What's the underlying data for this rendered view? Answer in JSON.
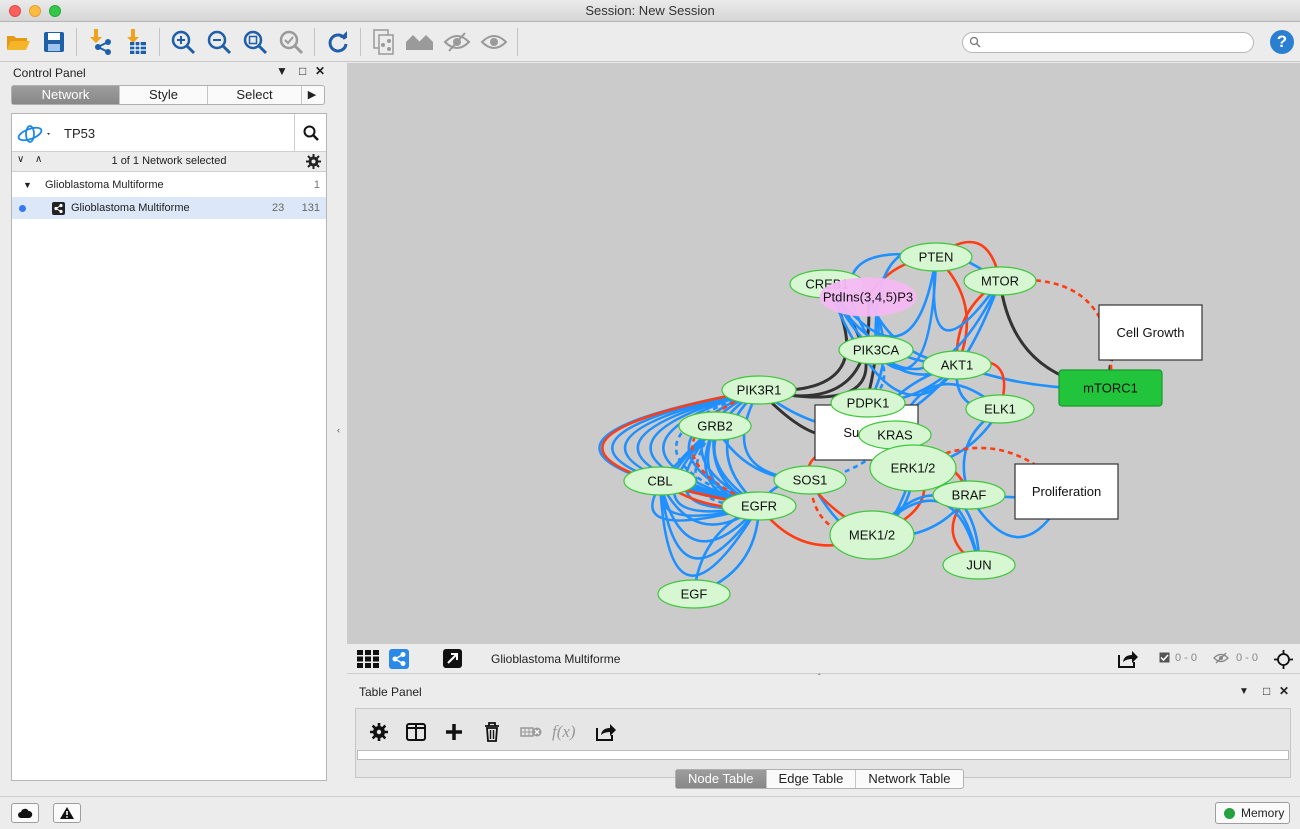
{
  "window": {
    "title": "Session: New Session"
  },
  "toolbar": {
    "icons": [
      "open-session-icon",
      "save-session-icon",
      "import-network-icon",
      "import-table-icon",
      "zoom-in-icon",
      "zoom-out-icon",
      "zoom-fit-icon",
      "zoom-selected-icon",
      "refresh-layout-icon",
      "new-network-from-selection-icon",
      "show-all-icon",
      "hide-selected-icon",
      "show-selected-icon"
    ],
    "search": {
      "value": "",
      "placeholder": ""
    },
    "help_label": "?"
  },
  "control_panel": {
    "title": "Control Panel",
    "tabs": [
      "Network",
      "Style",
      "Select"
    ],
    "active_tab": "Network",
    "search_value": "TP53",
    "selection_text": "1 of 1 Network selected",
    "tree": [
      {
        "name": "Glioblastoma Multiforme",
        "count": "1"
      },
      {
        "name": "Glioblastoma Multiforme",
        "nodes": "23",
        "edges": "131"
      }
    ]
  },
  "network": {
    "title": "Glioblastoma Multiforme",
    "colors": {
      "background": "#cbcbcb",
      "node_fill": "#d6f7d2",
      "node_stroke": "#3ec63a",
      "edge_activation": "#1e90ff",
      "edge_inhibition": "#ff3d14",
      "edge_other": "#333333",
      "mtorc1_fill": "#21c43a",
      "pip3_fill": "#f6baf5"
    },
    "nodes": [
      {
        "id": "PTEN",
        "label": "PTEN"
      },
      {
        "id": "MTOR",
        "label": "MTOR"
      },
      {
        "id": "CREB1",
        "label": "CREB1"
      },
      {
        "id": "PIP3",
        "label": "PtdIns(3,4,5)P3"
      },
      {
        "id": "CellGrowth",
        "label": "Cell Growth"
      },
      {
        "id": "PIK3CA",
        "label": "PIK3CA"
      },
      {
        "id": "AKT1",
        "label": "AKT1"
      },
      {
        "id": "mTORC1",
        "label": "mTORC1"
      },
      {
        "id": "PIK3R1",
        "label": "PIK3R1"
      },
      {
        "id": "Survival",
        "label": "Survival"
      },
      {
        "id": "PDPK1",
        "label": "PDPK1"
      },
      {
        "id": "ELK1",
        "label": "ELK1"
      },
      {
        "id": "GRB2",
        "label": "GRB2"
      },
      {
        "id": "KRAS",
        "label": "KRAS"
      },
      {
        "id": "Proliferation",
        "label": "Proliferation"
      },
      {
        "id": "ERK12",
        "label": "ERK1/2"
      },
      {
        "id": "CBL",
        "label": "CBL"
      },
      {
        "id": "SOS1",
        "label": "SOS1"
      },
      {
        "id": "BRAF",
        "label": "BRAF"
      },
      {
        "id": "EGFR",
        "label": "EGFR"
      },
      {
        "id": "MEK12",
        "label": "MEK1/2"
      },
      {
        "id": "JUN",
        "label": "JUN"
      },
      {
        "id": "EGF",
        "label": "EGF"
      }
    ]
  },
  "view_bar": {
    "network_title": "Glioblastoma Multiforme",
    "selected_nodes": "0 - 0",
    "hidden_nodes": "0 - 0"
  },
  "table_panel": {
    "title": "Table Panel",
    "tabs": [
      "Node Table",
      "Edge Table",
      "Network Table"
    ],
    "active_tab": "Node Table",
    "function_label": "f(x)"
  },
  "status_bar": {
    "memory_label": "Memory"
  }
}
